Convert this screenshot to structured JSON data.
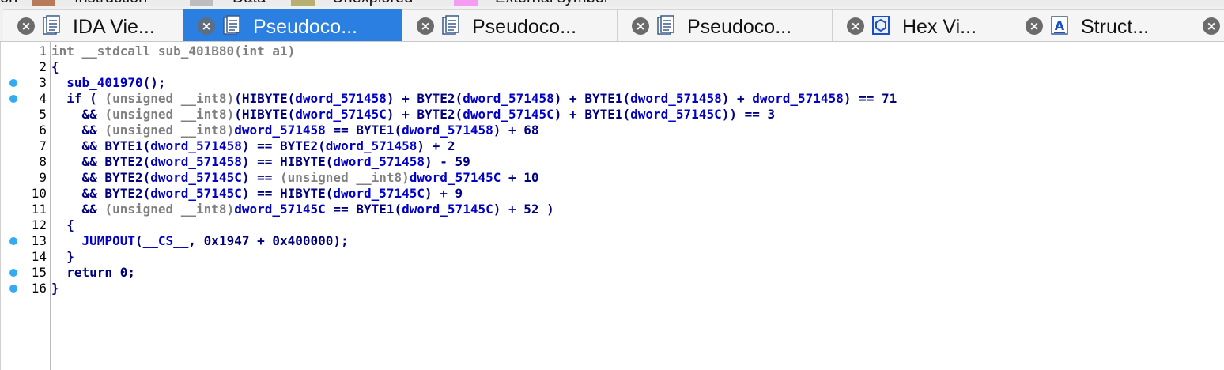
{
  "legend": [
    {
      "label": "on",
      "swatch": null
    },
    {
      "label": "Instruction",
      "swatch": "#b87a58"
    },
    {
      "label": "Data",
      "swatch": "#bdbdbd"
    },
    {
      "label": "Unexplored",
      "swatch": "#b7b070"
    },
    {
      "label": "External symbol",
      "swatch": "#f49cf2"
    }
  ],
  "tabs": [
    {
      "label": "IDA Vie...",
      "icon": "listing-icon",
      "active": false
    },
    {
      "label": "Pseudoco...",
      "icon": "listing-icon",
      "active": true
    },
    {
      "label": "Pseudoco...",
      "icon": "listing-icon",
      "active": false
    },
    {
      "label": "Pseudoco...",
      "icon": "listing-icon",
      "active": false
    },
    {
      "label": "Hex Vi...",
      "icon": "hex-icon",
      "active": false
    },
    {
      "label": "Struct...",
      "icon": "struct-icon",
      "active": false
    },
    {
      "label": "",
      "icon": null,
      "active": false
    }
  ],
  "colors": {
    "accent": "#2b7fe0",
    "keyword": "#000080",
    "identifier": "#0000c8",
    "cast": "#808080",
    "breakpoint_dot": "#34aaf0"
  },
  "code": [
    {
      "num": "1",
      "dot": false,
      "tokens": [
        [
          "int __stdcall sub_401B80(int a1)",
          "gray"
        ]
      ]
    },
    {
      "num": "2",
      "dot": false,
      "tokens": [
        [
          "{",
          "blk"
        ]
      ]
    },
    {
      "num": "3",
      "dot": true,
      "tokens": [
        [
          "  ",
          "blk"
        ],
        [
          "sub_401970",
          "id"
        ],
        [
          "();",
          "blk"
        ]
      ]
    },
    {
      "num": "4",
      "dot": true,
      "tokens": [
        [
          "  if ( ",
          "blk"
        ],
        [
          "(unsigned __int8)",
          "gray"
        ],
        [
          "(HIBYTE(",
          "blk"
        ],
        [
          "dword_571458",
          "id"
        ],
        [
          ") + BYTE2(",
          "blk"
        ],
        [
          "dword_571458",
          "id"
        ],
        [
          ") + BYTE1(",
          "blk"
        ],
        [
          "dword_571458",
          "id"
        ],
        [
          ") + ",
          "blk"
        ],
        [
          "dword_571458",
          "id"
        ],
        [
          ") == 71",
          "blk"
        ]
      ]
    },
    {
      "num": "5",
      "dot": false,
      "tokens": [
        [
          "    && ",
          "blk"
        ],
        [
          "(unsigned __int8)",
          "gray"
        ],
        [
          "(HIBYTE(",
          "blk"
        ],
        [
          "dword_57145C",
          "id"
        ],
        [
          ") + BYTE2(",
          "blk"
        ],
        [
          "dword_57145C",
          "id"
        ],
        [
          ") + BYTE1(",
          "blk"
        ],
        [
          "dword_57145C",
          "id"
        ],
        [
          ")) == 3",
          "blk"
        ]
      ]
    },
    {
      "num": "6",
      "dot": false,
      "tokens": [
        [
          "    && ",
          "blk"
        ],
        [
          "(unsigned __int8)",
          "gray"
        ],
        [
          "dword_571458",
          "id"
        ],
        [
          " == BYTE1(",
          "blk"
        ],
        [
          "dword_571458",
          "id"
        ],
        [
          ") + 68",
          "blk"
        ]
      ]
    },
    {
      "num": "7",
      "dot": false,
      "tokens": [
        [
          "    && BYTE1(",
          "blk"
        ],
        [
          "dword_571458",
          "id"
        ],
        [
          ") == BYTE2(",
          "blk"
        ],
        [
          "dword_571458",
          "id"
        ],
        [
          ") + 2",
          "blk"
        ]
      ]
    },
    {
      "num": "8",
      "dot": false,
      "tokens": [
        [
          "    && BYTE2(",
          "blk"
        ],
        [
          "dword_571458",
          "id"
        ],
        [
          ") == HIBYTE(",
          "blk"
        ],
        [
          "dword_571458",
          "id"
        ],
        [
          ") - 59",
          "blk"
        ]
      ]
    },
    {
      "num": "9",
      "dot": false,
      "tokens": [
        [
          "    && BYTE2(",
          "blk"
        ],
        [
          "dword_57145C",
          "id"
        ],
        [
          ") == ",
          "blk"
        ],
        [
          "(unsigned __int8)",
          "gray"
        ],
        [
          "dword_57145C",
          "id"
        ],
        [
          " + 10",
          "blk"
        ]
      ]
    },
    {
      "num": "10",
      "dot": false,
      "tokens": [
        [
          "    && BYTE2(",
          "blk"
        ],
        [
          "dword_57145C",
          "id"
        ],
        [
          ") == HIBYTE(",
          "blk"
        ],
        [
          "dword_57145C",
          "id"
        ],
        [
          ") + 9",
          "blk"
        ]
      ]
    },
    {
      "num": "11",
      "dot": false,
      "tokens": [
        [
          "    && ",
          "blk"
        ],
        [
          "(unsigned __int8)",
          "gray"
        ],
        [
          "dword_57145C",
          "id"
        ],
        [
          " == BYTE1(",
          "blk"
        ],
        [
          "dword_57145C",
          "id"
        ],
        [
          ") + 52 )",
          "blk"
        ]
      ]
    },
    {
      "num": "12",
      "dot": false,
      "tokens": [
        [
          "  {",
          "blk"
        ]
      ]
    },
    {
      "num": "13",
      "dot": true,
      "tokens": [
        [
          "    ",
          "blk"
        ],
        [
          "JUMPOUT",
          "id"
        ],
        [
          "(",
          "blk"
        ],
        [
          "__CS__",
          "id"
        ],
        [
          ", 0x1947 + 0x400000);",
          "blk"
        ]
      ]
    },
    {
      "num": "14",
      "dot": false,
      "tokens": [
        [
          "  }",
          "blk"
        ]
      ]
    },
    {
      "num": "15",
      "dot": true,
      "tokens": [
        [
          "  return 0;",
          "blk"
        ]
      ]
    },
    {
      "num": "16",
      "dot": true,
      "tokens": [
        [
          "}",
          "blk"
        ]
      ]
    }
  ]
}
